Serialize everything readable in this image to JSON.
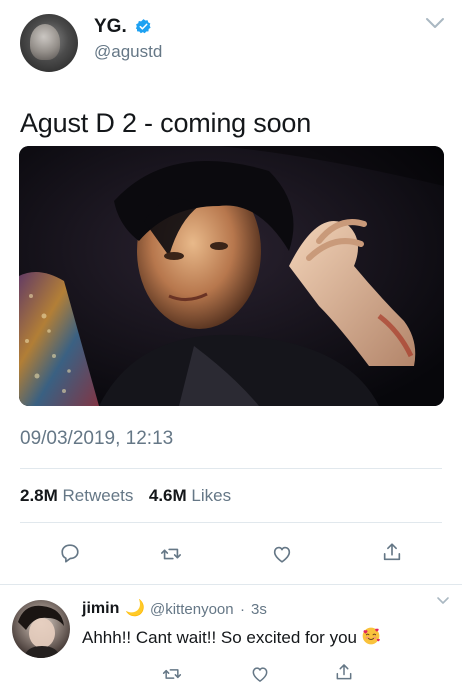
{
  "tweet": {
    "author_name": "YG.",
    "author_handle": "@agustd",
    "verified": true,
    "text": "Agust D 2 - coming soon",
    "timestamp": "09/03/2019, 12:13",
    "retweets_count": "2.8M",
    "retweets_label": "Retweets",
    "likes_count": "4.6M",
    "likes_label": "Likes",
    "menu_icon": "chevron-down-icon",
    "action_icons": [
      "reply-icon",
      "retweet-icon",
      "like-icon",
      "share-icon"
    ]
  },
  "reply": {
    "author_name": "jimin",
    "name_emoji": "🌙",
    "author_handle": "@kittenyoon",
    "separator": "·",
    "time_ago": "3s",
    "text": "Ahhh!! Cant wait!! So excited for you",
    "text_emoji": "smiling-face-with-hearts",
    "menu_icon": "chevron-down-icon",
    "action_icons": [
      "retweet-icon",
      "like-icon",
      "share-icon"
    ]
  },
  "colors": {
    "text_primary": "#14171a",
    "text_secondary": "#657786",
    "verified_blue": "#1da1f2",
    "divider": "#e1e8ed"
  }
}
